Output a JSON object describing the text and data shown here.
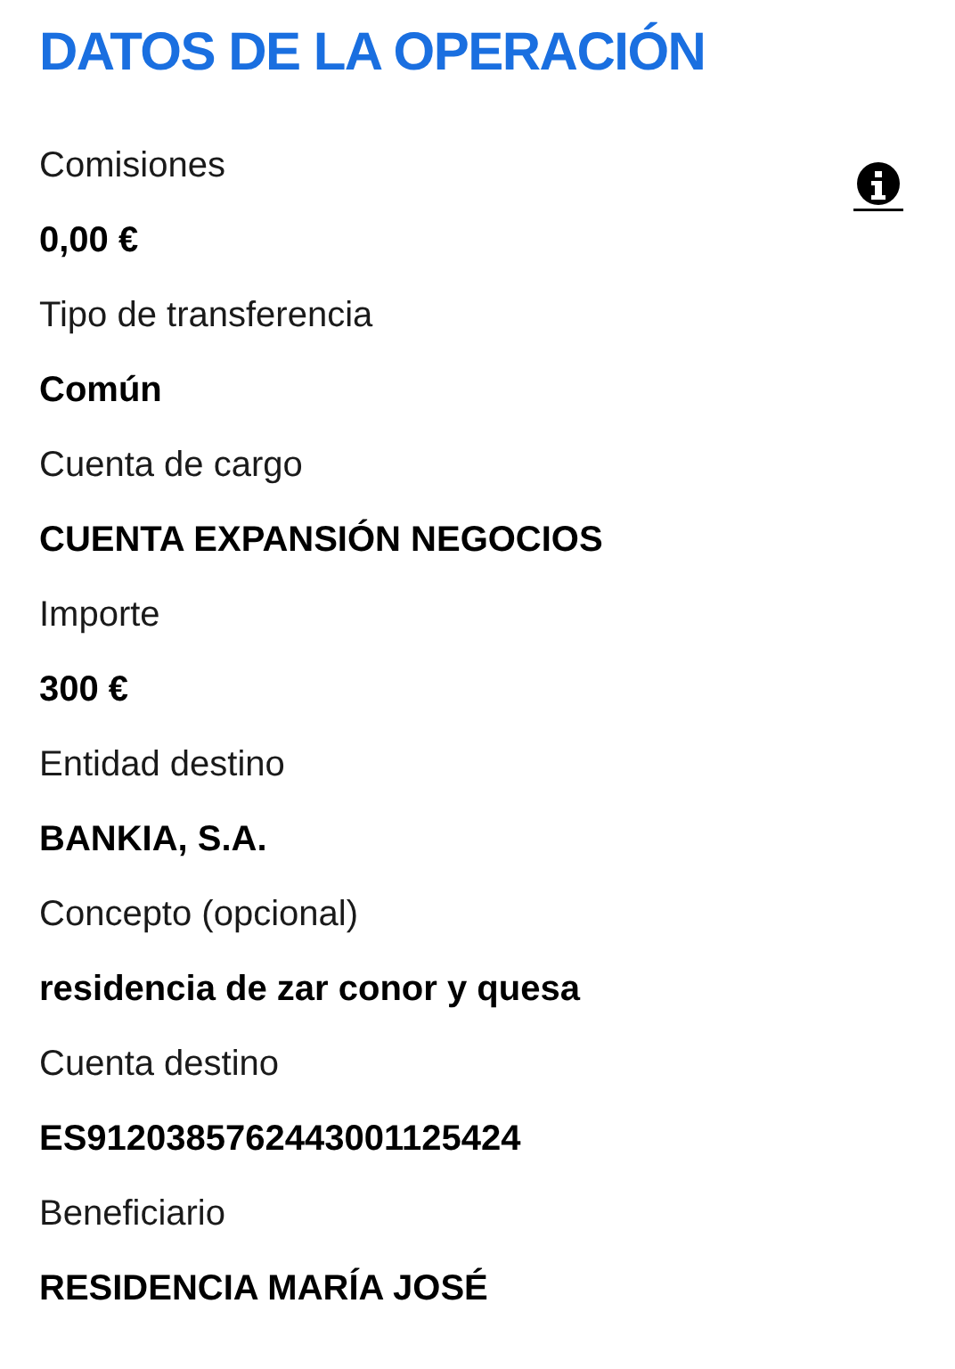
{
  "title": "DATOS DE LA OPERACIÓN",
  "fields": [
    {
      "label": "Comisiones",
      "value": "0,00 €",
      "info": true
    },
    {
      "label": "Tipo de transferencia",
      "value": "Común"
    },
    {
      "label": "Cuenta de cargo",
      "value": "CUENTA EXPANSIÓN NEGOCIOS"
    },
    {
      "label": "Importe",
      "value": "300 €"
    },
    {
      "label": "Entidad destino",
      "value": "BANKIA, S.A."
    },
    {
      "label": "Concepto (opcional)",
      "value": "residencia de zar conor y quesa"
    },
    {
      "label": "Cuenta destino",
      "value": "ES9120385762443001125424"
    },
    {
      "label": "Beneficiario",
      "value": "RESIDENCIA MARÍA JOSÉ"
    }
  ]
}
